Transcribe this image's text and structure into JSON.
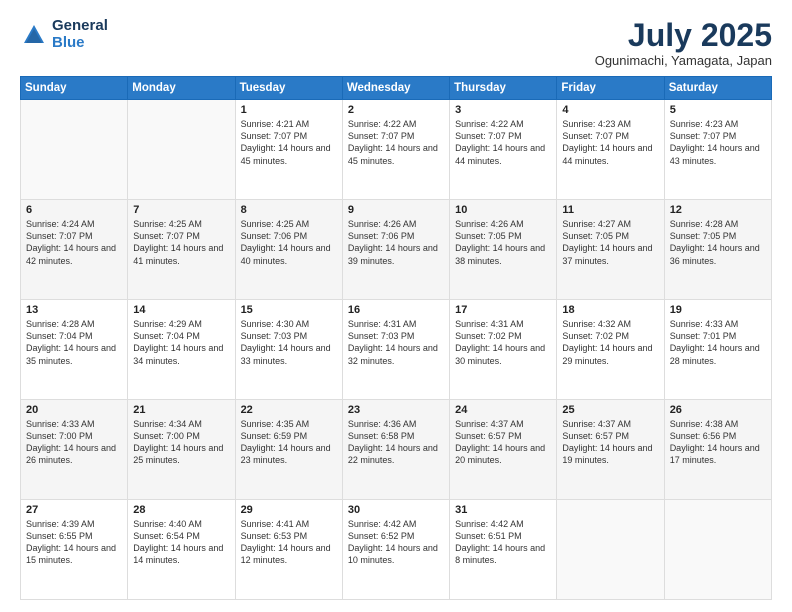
{
  "header": {
    "logo_general": "General",
    "logo_blue": "Blue",
    "month_title": "July 2025",
    "location": "Ogunimachi, Yamagata, Japan"
  },
  "weekdays": [
    "Sunday",
    "Monday",
    "Tuesday",
    "Wednesday",
    "Thursday",
    "Friday",
    "Saturday"
  ],
  "weeks": [
    [
      {
        "day": "",
        "text": ""
      },
      {
        "day": "",
        "text": ""
      },
      {
        "day": "1",
        "text": "Sunrise: 4:21 AM\nSunset: 7:07 PM\nDaylight: 14 hours and 45 minutes."
      },
      {
        "day": "2",
        "text": "Sunrise: 4:22 AM\nSunset: 7:07 PM\nDaylight: 14 hours and 45 minutes."
      },
      {
        "day": "3",
        "text": "Sunrise: 4:22 AM\nSunset: 7:07 PM\nDaylight: 14 hours and 44 minutes."
      },
      {
        "day": "4",
        "text": "Sunrise: 4:23 AM\nSunset: 7:07 PM\nDaylight: 14 hours and 44 minutes."
      },
      {
        "day": "5",
        "text": "Sunrise: 4:23 AM\nSunset: 7:07 PM\nDaylight: 14 hours and 43 minutes."
      }
    ],
    [
      {
        "day": "6",
        "text": "Sunrise: 4:24 AM\nSunset: 7:07 PM\nDaylight: 14 hours and 42 minutes."
      },
      {
        "day": "7",
        "text": "Sunrise: 4:25 AM\nSunset: 7:07 PM\nDaylight: 14 hours and 41 minutes."
      },
      {
        "day": "8",
        "text": "Sunrise: 4:25 AM\nSunset: 7:06 PM\nDaylight: 14 hours and 40 minutes."
      },
      {
        "day": "9",
        "text": "Sunrise: 4:26 AM\nSunset: 7:06 PM\nDaylight: 14 hours and 39 minutes."
      },
      {
        "day": "10",
        "text": "Sunrise: 4:26 AM\nSunset: 7:05 PM\nDaylight: 14 hours and 38 minutes."
      },
      {
        "day": "11",
        "text": "Sunrise: 4:27 AM\nSunset: 7:05 PM\nDaylight: 14 hours and 37 minutes."
      },
      {
        "day": "12",
        "text": "Sunrise: 4:28 AM\nSunset: 7:05 PM\nDaylight: 14 hours and 36 minutes."
      }
    ],
    [
      {
        "day": "13",
        "text": "Sunrise: 4:28 AM\nSunset: 7:04 PM\nDaylight: 14 hours and 35 minutes."
      },
      {
        "day": "14",
        "text": "Sunrise: 4:29 AM\nSunset: 7:04 PM\nDaylight: 14 hours and 34 minutes."
      },
      {
        "day": "15",
        "text": "Sunrise: 4:30 AM\nSunset: 7:03 PM\nDaylight: 14 hours and 33 minutes."
      },
      {
        "day": "16",
        "text": "Sunrise: 4:31 AM\nSunset: 7:03 PM\nDaylight: 14 hours and 32 minutes."
      },
      {
        "day": "17",
        "text": "Sunrise: 4:31 AM\nSunset: 7:02 PM\nDaylight: 14 hours and 30 minutes."
      },
      {
        "day": "18",
        "text": "Sunrise: 4:32 AM\nSunset: 7:02 PM\nDaylight: 14 hours and 29 minutes."
      },
      {
        "day": "19",
        "text": "Sunrise: 4:33 AM\nSunset: 7:01 PM\nDaylight: 14 hours and 28 minutes."
      }
    ],
    [
      {
        "day": "20",
        "text": "Sunrise: 4:33 AM\nSunset: 7:00 PM\nDaylight: 14 hours and 26 minutes."
      },
      {
        "day": "21",
        "text": "Sunrise: 4:34 AM\nSunset: 7:00 PM\nDaylight: 14 hours and 25 minutes."
      },
      {
        "day": "22",
        "text": "Sunrise: 4:35 AM\nSunset: 6:59 PM\nDaylight: 14 hours and 23 minutes."
      },
      {
        "day": "23",
        "text": "Sunrise: 4:36 AM\nSunset: 6:58 PM\nDaylight: 14 hours and 22 minutes."
      },
      {
        "day": "24",
        "text": "Sunrise: 4:37 AM\nSunset: 6:57 PM\nDaylight: 14 hours and 20 minutes."
      },
      {
        "day": "25",
        "text": "Sunrise: 4:37 AM\nSunset: 6:57 PM\nDaylight: 14 hours and 19 minutes."
      },
      {
        "day": "26",
        "text": "Sunrise: 4:38 AM\nSunset: 6:56 PM\nDaylight: 14 hours and 17 minutes."
      }
    ],
    [
      {
        "day": "27",
        "text": "Sunrise: 4:39 AM\nSunset: 6:55 PM\nDaylight: 14 hours and 15 minutes."
      },
      {
        "day": "28",
        "text": "Sunrise: 4:40 AM\nSunset: 6:54 PM\nDaylight: 14 hours and 14 minutes."
      },
      {
        "day": "29",
        "text": "Sunrise: 4:41 AM\nSunset: 6:53 PM\nDaylight: 14 hours and 12 minutes."
      },
      {
        "day": "30",
        "text": "Sunrise: 4:42 AM\nSunset: 6:52 PM\nDaylight: 14 hours and 10 minutes."
      },
      {
        "day": "31",
        "text": "Sunrise: 4:42 AM\nSunset: 6:51 PM\nDaylight: 14 hours and 8 minutes."
      },
      {
        "day": "",
        "text": ""
      },
      {
        "day": "",
        "text": ""
      }
    ]
  ]
}
